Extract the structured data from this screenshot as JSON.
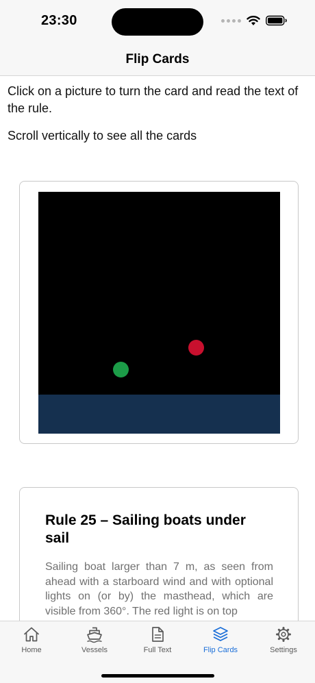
{
  "status_bar": {
    "time": "23:30"
  },
  "nav": {
    "title": "Flip Cards"
  },
  "intro": {
    "line1": "Click on a picture to turn the card and read the text of the rule.",
    "line2": "Scroll vertically to see all the cards"
  },
  "picture_card": {
    "lights": [
      "red",
      "green"
    ],
    "colors": {
      "sky": "#000000",
      "sea": "#15304f",
      "red": "#c8102e",
      "green": "#1c9c48"
    }
  },
  "rule_card": {
    "title": "Rule 25 – Sailing boats under sail",
    "body": "Sailing boat larger than 7 m, as seen from ahead with a starboard wind and with optional lights on (or by) the masthead, which are visible from 360°. The red light is on top"
  },
  "tabs": [
    {
      "label": "Home",
      "icon": "house-icon"
    },
    {
      "label": "Vessels",
      "icon": "ship-icon"
    },
    {
      "label": "Full Text",
      "icon": "document-icon"
    },
    {
      "label": "Flip Cards",
      "icon": "stack-icon",
      "active": true
    },
    {
      "label": "Settings",
      "icon": "gear-icon"
    }
  ],
  "colors": {
    "accent": "#1a6ed8",
    "inactive": "#5a5a5a"
  }
}
